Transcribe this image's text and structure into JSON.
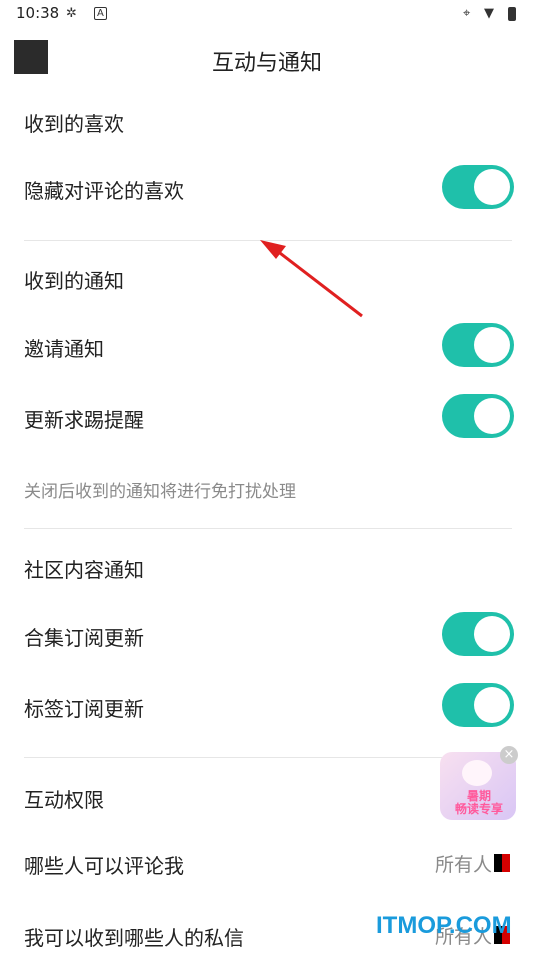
{
  "status_bar": {
    "time": "10:38"
  },
  "header": {
    "title": "互动与通知"
  },
  "sections": {
    "likes": {
      "title": "收到的喜欢",
      "items": [
        {
          "label": "隐藏对评论的喜欢",
          "on": true
        }
      ]
    },
    "notifications": {
      "title": "收到的通知",
      "items": [
        {
          "label": "邀请通知",
          "on": true
        },
        {
          "label": "更新求踢提醒",
          "on": true
        }
      ],
      "hint": "关闭后收到的通知将进行免打扰处理"
    },
    "community": {
      "title": "社区内容通知",
      "items": [
        {
          "label": "合集订阅更新",
          "on": true
        },
        {
          "label": "标签订阅更新",
          "on": true
        }
      ]
    },
    "permissions": {
      "title": "互动权限",
      "items": [
        {
          "label": "哪些人可以评论我",
          "value": "所有人"
        },
        {
          "label": "我可以收到哪些人的私信",
          "value": "所有人"
        }
      ]
    }
  },
  "promo": {
    "line1": "暑期",
    "line2": "畅读专享"
  },
  "watermark": "ITMOP.COM",
  "colors": {
    "accent": "#1fc0aa",
    "annotation_arrow": "#e02020"
  }
}
